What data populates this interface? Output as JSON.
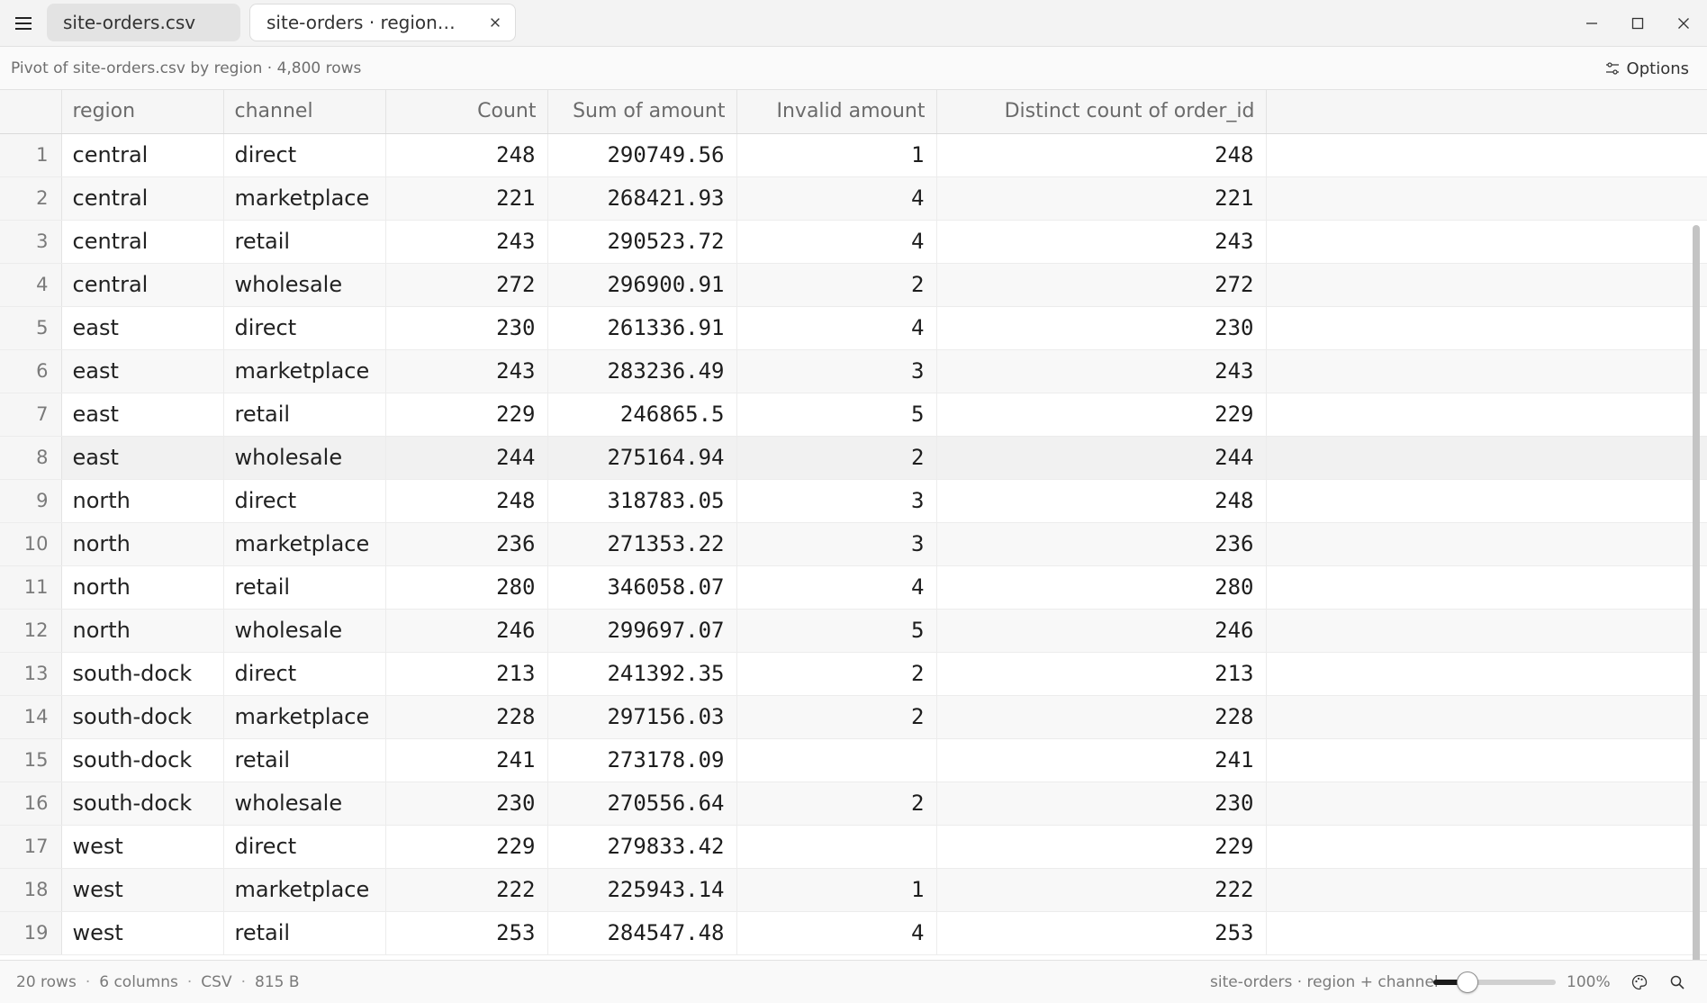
{
  "tabs": [
    {
      "label": "site-orders.csv"
    },
    {
      "label": "site-orders · region…"
    }
  ],
  "info": {
    "text": "Pivot of site-orders.csv by region · 4,800 rows",
    "options_label": "Options"
  },
  "table": {
    "columns": [
      "region",
      "channel",
      "Count",
      "Sum of amount",
      "Invalid amount",
      "Distinct count of order_id"
    ],
    "highlighted_row": 8,
    "rows": [
      {
        "n": "1",
        "region": "central",
        "channel": "direct",
        "count": "248",
        "sum": "290749.56",
        "invalid": "1",
        "distinct": "248"
      },
      {
        "n": "2",
        "region": "central",
        "channel": "marketplace",
        "count": "221",
        "sum": "268421.93",
        "invalid": "4",
        "distinct": "221"
      },
      {
        "n": "3",
        "region": "central",
        "channel": "retail",
        "count": "243",
        "sum": "290523.72",
        "invalid": "4",
        "distinct": "243"
      },
      {
        "n": "4",
        "region": "central",
        "channel": "wholesale",
        "count": "272",
        "sum": "296900.91",
        "invalid": "2",
        "distinct": "272"
      },
      {
        "n": "5",
        "region": "east",
        "channel": "direct",
        "count": "230",
        "sum": "261336.91",
        "invalid": "4",
        "distinct": "230"
      },
      {
        "n": "6",
        "region": "east",
        "channel": "marketplace",
        "count": "243",
        "sum": "283236.49",
        "invalid": "3",
        "distinct": "243"
      },
      {
        "n": "7",
        "region": "east",
        "channel": "retail",
        "count": "229",
        "sum": "246865.5",
        "invalid": "5",
        "distinct": "229"
      },
      {
        "n": "8",
        "region": "east",
        "channel": "wholesale",
        "count": "244",
        "sum": "275164.94",
        "invalid": "2",
        "distinct": "244"
      },
      {
        "n": "9",
        "region": "north",
        "channel": "direct",
        "count": "248",
        "sum": "318783.05",
        "invalid": "3",
        "distinct": "248"
      },
      {
        "n": "10",
        "region": "north",
        "channel": "marketplace",
        "count": "236",
        "sum": "271353.22",
        "invalid": "3",
        "distinct": "236"
      },
      {
        "n": "11",
        "region": "north",
        "channel": "retail",
        "count": "280",
        "sum": "346058.07",
        "invalid": "4",
        "distinct": "280"
      },
      {
        "n": "12",
        "region": "north",
        "channel": "wholesale",
        "count": "246",
        "sum": "299697.07",
        "invalid": "5",
        "distinct": "246"
      },
      {
        "n": "13",
        "region": "south-dock",
        "channel": "direct",
        "count": "213",
        "sum": "241392.35",
        "invalid": "2",
        "distinct": "213"
      },
      {
        "n": "14",
        "region": "south-dock",
        "channel": "marketplace",
        "count": "228",
        "sum": "297156.03",
        "invalid": "2",
        "distinct": "228"
      },
      {
        "n": "15",
        "region": "south-dock",
        "channel": "retail",
        "count": "241",
        "sum": "273178.09",
        "invalid": "",
        "distinct": "241"
      },
      {
        "n": "16",
        "region": "south-dock",
        "channel": "wholesale",
        "count": "230",
        "sum": "270556.64",
        "invalid": "2",
        "distinct": "230"
      },
      {
        "n": "17",
        "region": "west",
        "channel": "direct",
        "count": "229",
        "sum": "279833.42",
        "invalid": "",
        "distinct": "229"
      },
      {
        "n": "18",
        "region": "west",
        "channel": "marketplace",
        "count": "222",
        "sum": "225943.14",
        "invalid": "1",
        "distinct": "222"
      },
      {
        "n": "19",
        "region": "west",
        "channel": "retail",
        "count": "253",
        "sum": "284547.48",
        "invalid": "4",
        "distinct": "253"
      }
    ]
  },
  "status": {
    "rows": "20 rows",
    "columns": "6 columns",
    "format": "CSV",
    "size": "815 B",
    "view": "site-orders · region + channel",
    "zoom_label": "100%",
    "zoom_fraction": 0.28
  },
  "icons": {
    "menu": "hamburger-menu-icon",
    "close_tab": "close-icon",
    "minimize": "minimize-icon",
    "maximize": "maximize-icon",
    "close_window": "close-icon",
    "options": "sliders-icon",
    "palette": "palette-icon",
    "search": "search-icon"
  }
}
